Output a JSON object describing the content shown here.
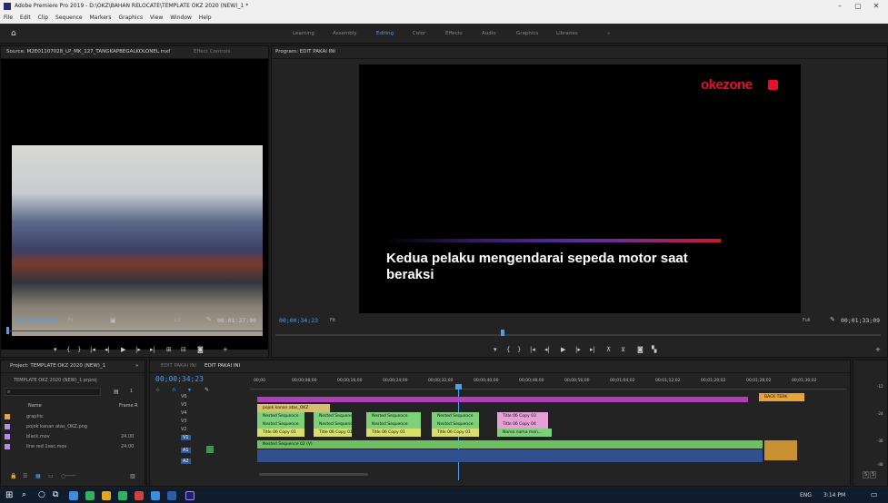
{
  "window": {
    "title": "Adobe Premiere Pro 2019 - D:\\OKZ\\BAHAN RELOCATE\\TEMPLATE OKZ 2020 (NEW)_1 *",
    "controls": [
      "–",
      "▢",
      "✕"
    ]
  },
  "menu": [
    "File",
    "Edit",
    "Clip",
    "Sequence",
    "Markers",
    "Graphics",
    "View",
    "Window",
    "Help"
  ],
  "workspaces": {
    "items": [
      "Learning",
      "Assembly",
      "Editing",
      "Color",
      "Effects",
      "Audio",
      "Graphics",
      "Libraries",
      "»"
    ],
    "active": "Editing"
  },
  "source_monitor": {
    "tab_label": "Source: M2E01107028_LP_MK_127_TANGKAPBEGALKOLONEL.mxf",
    "effect_controls_tab": "Effect Controls",
    "timecode_in": "01:00:00:00",
    "fit": "Fit",
    "scale": "1/2",
    "duration": "00:01:27:00"
  },
  "program_monitor": {
    "tab_label": "Program: EDIT PAKAI INI",
    "timecode": "00;00;34;23",
    "fit": "Fit",
    "scale": "Full",
    "duration": "00;01;33;09",
    "logo_text": "okezone",
    "caption_line1": "Kedua pelaku mengendarai sepeda motor saat",
    "caption_line2": "beraksi"
  },
  "project_panel": {
    "tab_label": "Project: TEMPLATE OKZ 2020 (NEW)_1",
    "file_label": "TEMPLATE OKZ 2020 (NEW)_1.prproj",
    "item_count": "1",
    "col_name": "Name",
    "col_framerate": "Frame R",
    "items": [
      {
        "name": "graphic",
        "rate": "",
        "color": "#e8a33c"
      },
      {
        "name": "pojok kanan atas_OKZ.png",
        "rate": "",
        "color": "#b48ee0"
      },
      {
        "name": "black.mov",
        "rate": "24.00",
        "color": "#b48ee0"
      },
      {
        "name": "line red 1sec.mov",
        "rate": "24.00",
        "color": "#b48ee0"
      }
    ]
  },
  "timeline": {
    "tabs": [
      "EDIT PAKAI INI",
      "EDIT PAKAI INI"
    ],
    "timecode": "00;00;34;23",
    "ruler": [
      "00;00",
      "00;00;08;00",
      "00;00;16;00",
      "00;00;24;00",
      "00;00;32;00",
      "00;00;40;00",
      "00;00;48;00",
      "00;00;56;00",
      "00;01;04;02",
      "00;01;12;02",
      "00;01;20;02",
      "00;01;28;02",
      "00;01;36;02"
    ],
    "video_tracks": [
      "V6",
      "V5",
      "V4",
      "V3",
      "V2",
      "V1"
    ],
    "audio_tracks": [
      "A1",
      "A2"
    ],
    "clip_labels": {
      "nested": "Nested Sequence",
      "title": "Title 06 Copy 03",
      "title2": "Title 06 Copy 01",
      "kanan": "pojok kanan atas_OKZ",
      "nested_v1": "Nested Sequence 02 (V)",
      "back": "BACK TERK",
      "title04": "Title 06 Copy 04",
      "bahan": "Nama nama men..."
    },
    "meter_labels": [
      "-12",
      "-24",
      "-36",
      "-48"
    ],
    "solo_labels": [
      "S",
      "S"
    ]
  },
  "taskbar": {
    "tray": "ENG",
    "time": "3:14 PM"
  }
}
